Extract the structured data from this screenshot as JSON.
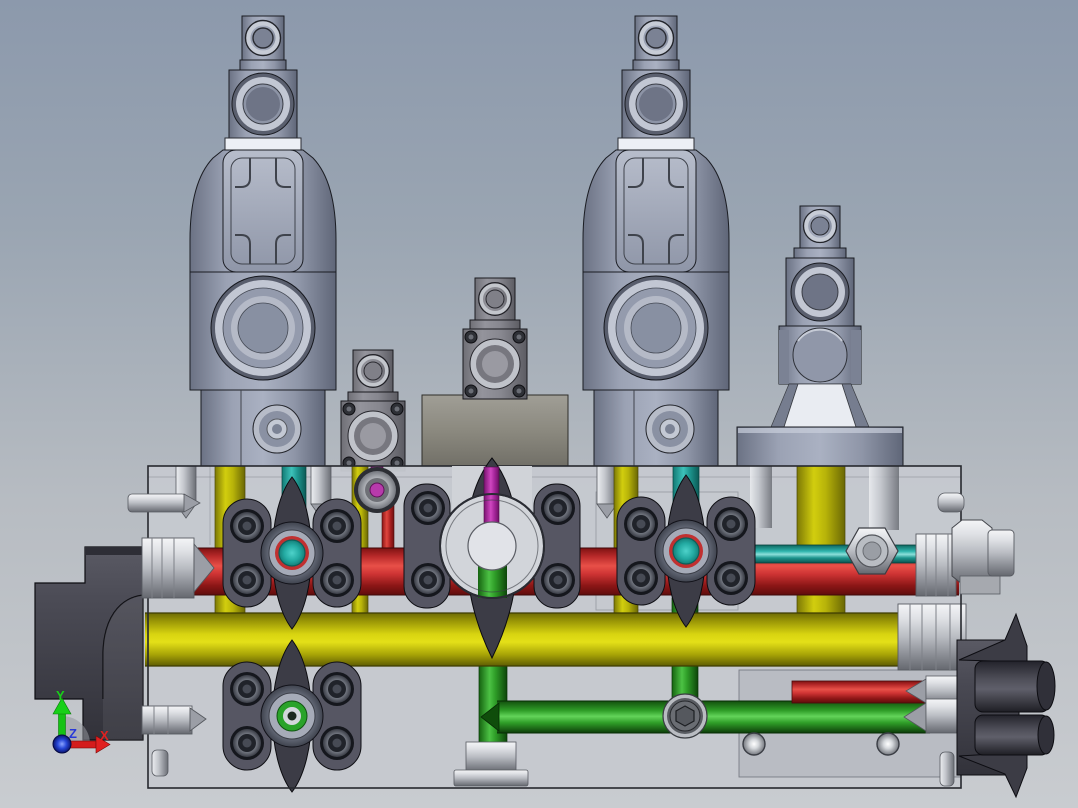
{
  "scene": {
    "description": "3D CAD viewport showing a hydraulic valve manifold assembly, front orthographic view",
    "background_top": "#8c99ac",
    "background_bottom": "#c9ccd0"
  },
  "axes": {
    "x_label": "X",
    "y_label": "Y",
    "z_label": "Z",
    "x_color": "#d41c1c",
    "y_color": "#18c818",
    "z_color": "#2042d8"
  },
  "colors": {
    "pipe_red": "#c62828",
    "pipe_yellow": "#cfcb0e",
    "pipe_green": "#2f9e28",
    "pipe_cyan": "#2fb5ad",
    "pipe_magenta": "#c23cb4",
    "valve_body": "#9ba2b4",
    "manifold_block": "#c6c9cf",
    "flange_dark": "#565663",
    "housing_dark": "#45454f",
    "steel": "#b9bcc2"
  },
  "components": [
    "solenoid-valve-left",
    "solenoid-valve-right",
    "cartridge-valve-small-left",
    "cartridge-valve-small-center",
    "relief-valve-right",
    "manifold-block",
    "sae-flange-left",
    "sae-flange-center",
    "sae-flange-right",
    "sae-flange-bottom",
    "left-port-housing",
    "right-port-housing",
    "hex-plug",
    "coordinate-triad"
  ]
}
